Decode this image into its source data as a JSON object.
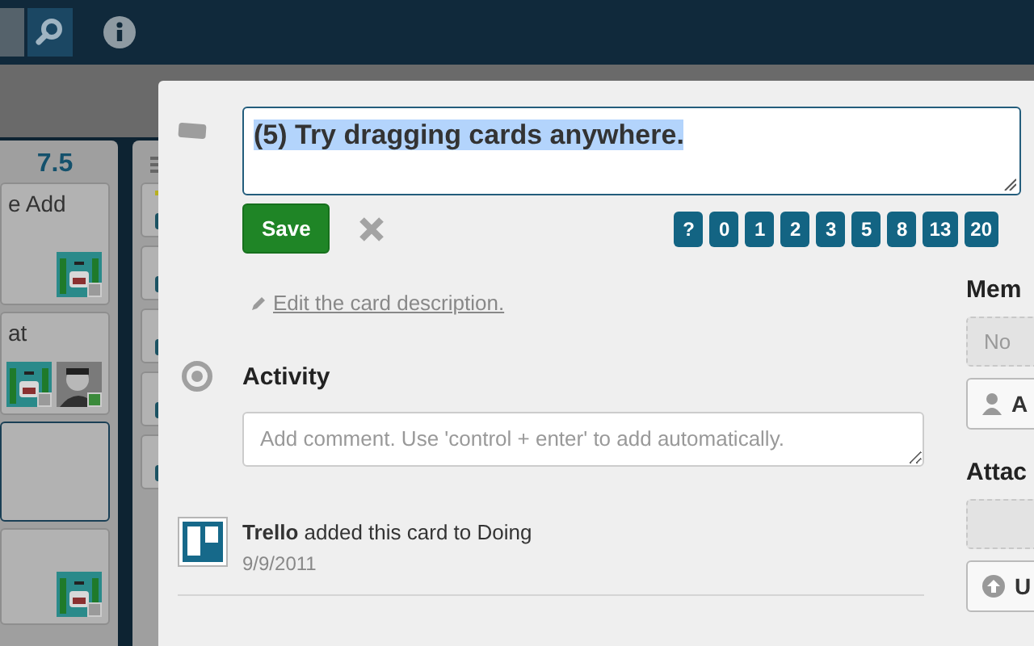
{
  "board": {
    "lists": [
      {
        "header": "7.5",
        "cards": [
          {
            "text": "e Add",
            "avatars": [
              {
                "kind": "robot",
                "online": false
              }
            ]
          },
          {
            "text": "at",
            "avatars": [
              {
                "kind": "robot",
                "online": false
              },
              {
                "kind": "person",
                "online": true
              }
            ]
          },
          {
            "selected": true
          },
          {
            "avatars": [
              {
                "kind": "robot",
                "online": false
              }
            ]
          }
        ]
      },
      {
        "cards": [
          {
            "labels": [
              {
                "color": "#b8b020"
              }
            ],
            "badge": true
          },
          {
            "badge": true
          },
          {
            "badge": true
          },
          {
            "badge": true
          },
          {
            "badge": true
          }
        ]
      }
    ]
  },
  "card": {
    "title": "(5) Try dragging cards anywhere.",
    "save": "Save",
    "estimates": [
      {
        "label": "?"
      },
      {
        "label": "0"
      },
      {
        "label": "1"
      },
      {
        "label": "2"
      },
      {
        "label": "3"
      },
      {
        "label": "5"
      },
      {
        "label": "8"
      },
      {
        "label": "13"
      },
      {
        "label": "20"
      }
    ],
    "edit_description": "Edit the card description.",
    "activity": {
      "heading": "Activity",
      "comment_placeholder": "Add comment. Use 'control + enter' to add automatically.",
      "entries": [
        {
          "author": "Trello",
          "action": "added this card to Doing",
          "date": "9/9/2011"
        }
      ]
    }
  },
  "sidebar": {
    "sections": [
      {
        "kind": "members",
        "heading": "Mem",
        "empty": "No",
        "button": "A"
      },
      {
        "kind": "attachments",
        "heading": "Attac",
        "button": "U"
      }
    ]
  }
}
